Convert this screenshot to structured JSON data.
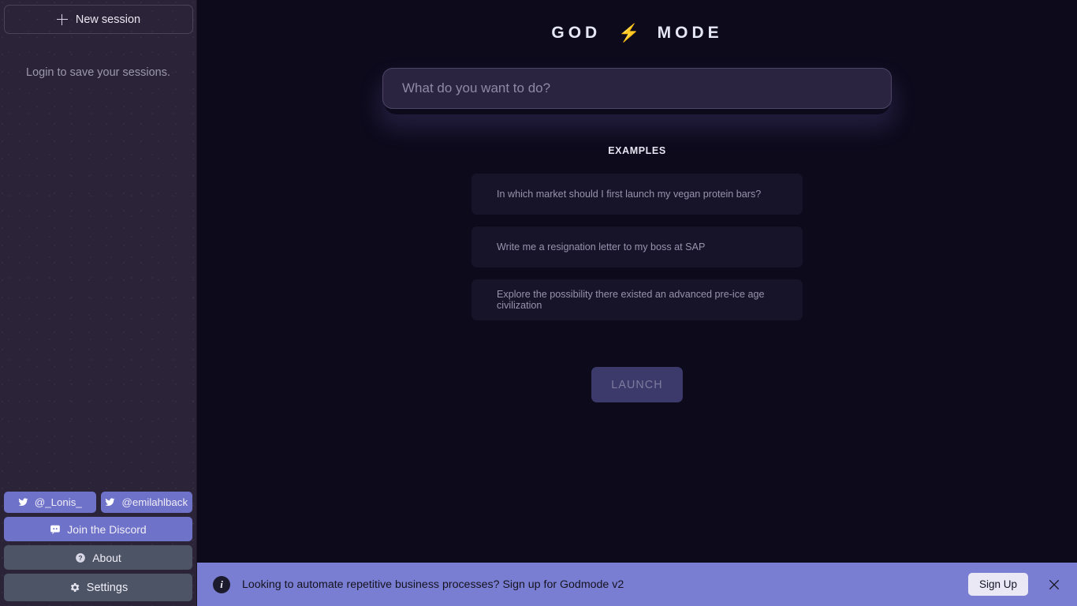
{
  "sidebar": {
    "new_session_label": "New session",
    "login_note": "Login to save your sessions.",
    "twitter_1": "@_Lonis_",
    "twitter_2": "@emilahlback",
    "discord_label": "Join the Discord",
    "about_label": "About",
    "settings_label": "Settings",
    "accent_purple": "#6f72c9",
    "accent_slate": "#4c5466",
    "background": "#2b2439"
  },
  "header": {
    "logo_left": "GOD",
    "logo_right": "MODE",
    "logo_bolt": "⚡",
    "bolt_color": "#f0a442"
  },
  "prompt": {
    "value": "",
    "placeholder": "What do you want to do?"
  },
  "examples": {
    "title": "EXAMPLES",
    "items": [
      {
        "text": "In which market should I first launch my vegan protein bars?"
      },
      {
        "text": "Write me a resignation letter to my boss at SAP"
      },
      {
        "text": "Explore the possibility there existed an advanced pre-ice age civilization"
      }
    ]
  },
  "launch": {
    "label": "LAUNCH",
    "color": "#3b3a6b"
  },
  "banner": {
    "icon": "info-icon",
    "icon_glyph": "i",
    "text": "Looking to automate repetitive business processes? Sign up for Godmode v2",
    "signup_label": "Sign Up",
    "close_label": "×",
    "background": "#7a7ed2"
  },
  "icons": {
    "plus": "plus-icon",
    "twitter": "twitter-icon",
    "discord": "discord-icon",
    "question": "question-mark-icon",
    "gear": "gear-icon",
    "close": "close-icon"
  }
}
